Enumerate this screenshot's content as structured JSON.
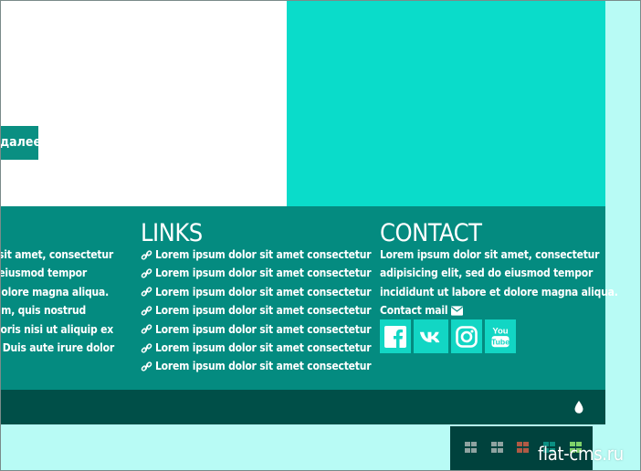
{
  "hero": {
    "more_button": "далее"
  },
  "footer": {
    "about_lines": [
      "Lorem ipsum dolor sit amet, consectetur",
      "adipisicing elit, sed do eiusmod tempor",
      "incididunt ut labore et dolore magna aliqua.",
      "Ut enim ad minim veniam, quis nostrud",
      "exercitation ullamco laboris nisi ut aliquip ex",
      "ea commodo consequat. Duis aute irure dolor"
    ],
    "links": {
      "heading": "LINKS",
      "items": [
        "Lorem ipsum dolor sit amet consectetur",
        "Lorem ipsum dolor sit amet consectetur",
        "Lorem ipsum dolor sit amet consectetur",
        "Lorem ipsum dolor sit amet consectetur",
        "Lorem ipsum dolor sit amet consectetur",
        "Lorem ipsum dolor sit amet consectetur",
        "Lorem ipsum dolor sit amet consectetur"
      ],
      "icon": "link-icon"
    },
    "contact": {
      "heading": "CONTACT",
      "lines": [
        "Lorem ipsum dolor sit amet, consectetur",
        "adipisicing elit, sed do eiusmod tempor",
        "incididunt ut labore et dolore magna aliqua."
      ],
      "mail_label": "Contact mail",
      "socials": [
        "facebook-icon",
        "vk-icon",
        "instagram-icon",
        "youtube-icon"
      ]
    }
  },
  "theme_switcher": {
    "swatches": [
      {
        "color": "#8fa3a1"
      },
      {
        "color": "#8fa3a1"
      },
      {
        "color": "#b05a45"
      },
      {
        "color": "#0a8f82"
      },
      {
        "color": "#7fd36a"
      }
    ]
  },
  "watermark": "flat-cms.ru",
  "colors": {
    "page_bg": "#b8fbf5",
    "accent_teal": "#0adcca",
    "footer_bg": "#048b80",
    "footer_bottom": "#004f48"
  }
}
